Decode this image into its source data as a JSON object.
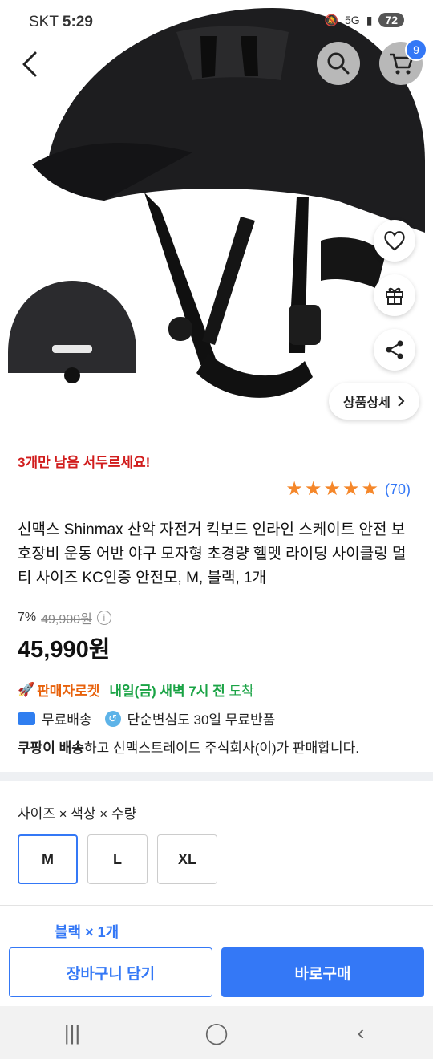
{
  "status_bar": {
    "carrier": "SKT",
    "time": "5:29",
    "network": "5G",
    "battery": "72"
  },
  "header": {
    "cart_count": "9",
    "icons": [
      "back-arrow-icon",
      "search-icon",
      "cart-icon"
    ]
  },
  "hero": {
    "detail_button": "상품상세",
    "side_icons": [
      "heart-icon",
      "gift-icon",
      "share-icon"
    ]
  },
  "product": {
    "stock_warning": "3개만 남음 서두르세요!",
    "rating_stars": 5,
    "rating_count": "(70)",
    "title": "신맥스 Shinmax 산악 자전거 킥보드 인라인 스케이트 안전 보호장비 운동 어반 야구 모자형 초경량 헬멧 라이딩 사이클링 멀티 사이즈 KC인증 안전모, M, 블랙, 1개",
    "discount_percent": "7%",
    "original_price": "49,900원",
    "sale_price": "45,990원"
  },
  "delivery": {
    "rocket_label": "판매자로켓",
    "arrival_bold": "내일(금) 새벽 7시 전",
    "arrival_suffix": "도착",
    "free_shipping": "무료배송",
    "free_return": "단순변심도 30일 무료반품",
    "seller_bold": "쿠팡이 배송",
    "seller_rest": "하고 신맥스트레이드 주식회사(이)가 판매합니다."
  },
  "options": {
    "label": "사이즈 × 색상 × 수량",
    "sizes": [
      "M",
      "L",
      "XL"
    ],
    "selected": "M",
    "summary": "블랙 × 1개"
  },
  "actions": {
    "add_to_cart": "장바구니 담기",
    "buy_now": "바로구매"
  },
  "colors": {
    "accent": "#3478f6",
    "warning": "#d11d1d",
    "rocket": "#e8620c",
    "arrival": "#1aa345",
    "star": "#f5872a"
  }
}
